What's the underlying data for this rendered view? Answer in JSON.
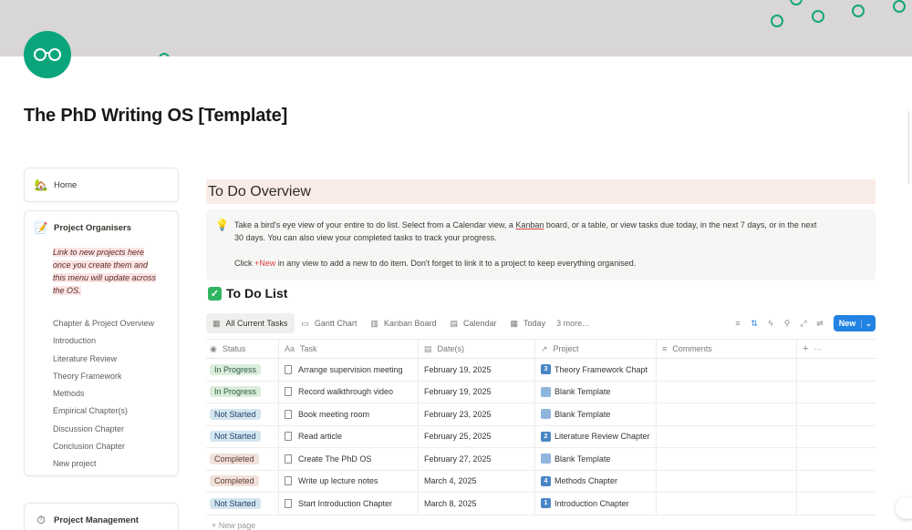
{
  "page": {
    "title": "The PhD Writing OS [Template]",
    "accent_color": "#0aa57c",
    "icon": "glasses-icon"
  },
  "sidebar": {
    "home": {
      "emoji": "🏡",
      "label": "Home"
    },
    "organisers": {
      "emoji": "📝",
      "label": "Project Organisers",
      "note": "Link to new projects here once you create them and this menu will update across the OS.",
      "links": [
        "Chapter & Project Overview",
        "Introduction",
        "Literature Review",
        "Theory Framework",
        "Methods",
        "Empirical Chapter(s)",
        "Discussion Chapter",
        "Conclusion Chapter",
        "New project"
      ]
    },
    "management": {
      "emoji": "⏱",
      "label": "Project Management"
    }
  },
  "overview": {
    "heading": "To Do Overview",
    "callout": {
      "icon": "💡",
      "line1_a": "Take a bird's eye view of your entire to do list. Select from a Calendar view, a ",
      "line1_link": "Kanban",
      "line1_b": " board, or a table, or view tasks due today, in the next 7 days, or in the next",
      "line2": "30 days. You can also view your completed tasks to track your progress.",
      "line3_a": "Click ",
      "line3_new": "+New",
      "line3_b": " in any view to add a new to do item. Don't forget to link it to a project to keep everything organised."
    }
  },
  "todo": {
    "heading": "To Do List",
    "views": [
      {
        "label": "All Current Tasks",
        "icon": "table-icon",
        "active": true
      },
      {
        "label": "Gantt Chart",
        "icon": "timeline-icon",
        "active": false
      },
      {
        "label": "Kanban Board",
        "icon": "board-icon",
        "active": false
      },
      {
        "label": "Calendar",
        "icon": "calendar-icon",
        "active": false
      },
      {
        "label": "Today",
        "icon": "table-icon",
        "active": false
      }
    ],
    "more_views": "3 more...",
    "new_button": "New",
    "columns": [
      "Status",
      "Task",
      "Date(s)",
      "Project",
      "Comments"
    ],
    "rows": [
      {
        "status": "In Progress",
        "task": "Arrange supervision meeting",
        "date": "February 19, 2025",
        "project_num": "3",
        "project": "Theory Framework Chapt"
      },
      {
        "status": "In Progress",
        "task": "Record walkthrough video",
        "date": "February 19, 2025",
        "project_num": "",
        "project": "Blank Template"
      },
      {
        "status": "Not Started",
        "task": "Book meeting room",
        "date": "February 23, 2025",
        "project_num": "",
        "project": "Blank Template"
      },
      {
        "status": "Not Started",
        "task": "Read article",
        "date": "February 25, 2025",
        "project_num": "2",
        "project": "Literature Review Chapter"
      },
      {
        "status": "Completed",
        "task": "Create The PhD OS",
        "date": "February 27, 2025",
        "project_num": "",
        "project": "Blank Template"
      },
      {
        "status": "Completed",
        "task": "Write up lecture notes",
        "date": "March 4, 2025",
        "project_num": "4",
        "project": "Methods Chapter"
      },
      {
        "status": "Not Started",
        "task": "Start Introduction Chapter",
        "date": "March 8, 2025",
        "project_num": "1",
        "project": "Introduction Chapter"
      }
    ],
    "new_page": "+ New page"
  }
}
